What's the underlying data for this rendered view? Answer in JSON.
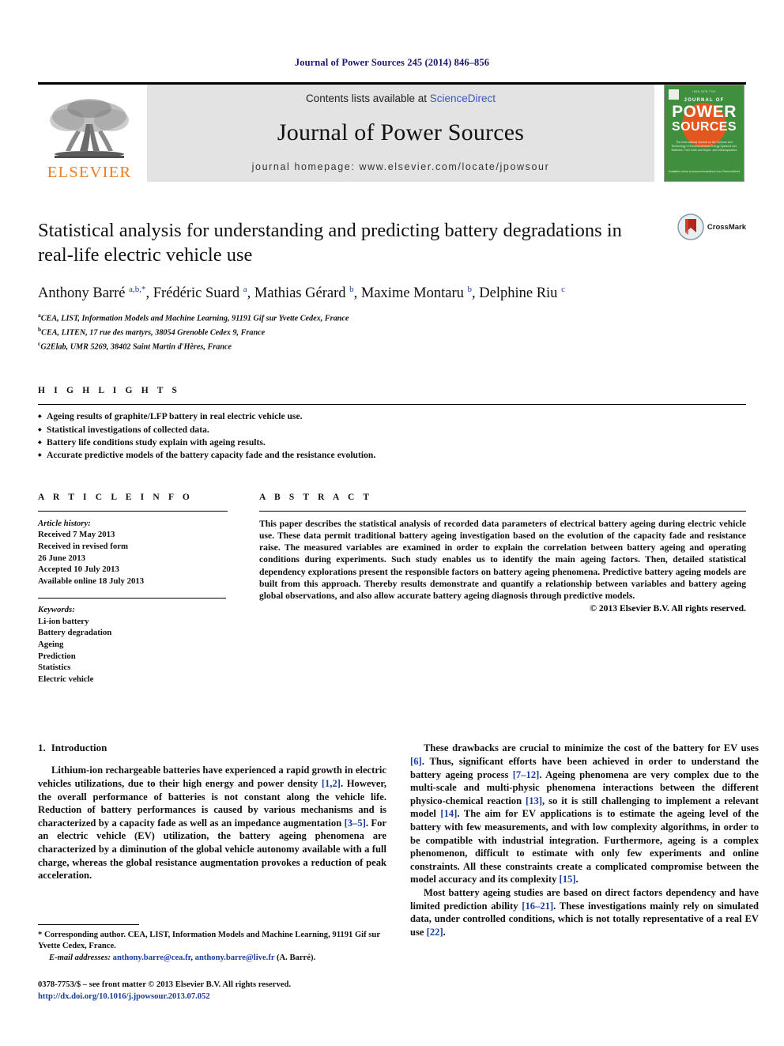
{
  "running_head": "Journal of Power Sources 245 (2014) 846–856",
  "masthead": {
    "publisher_name": "ELSEVIER",
    "contents_prefix": "Contents lists available at ",
    "contents_link": "ScienceDirect",
    "journal_name": "Journal of Power Sources",
    "homepage_line": "journal homepage: www.elsevier.com/locate/jpowsour",
    "cover": {
      "top_text": "ISSN 0378-7753",
      "journal_of": "JOURNAL OF",
      "power": "POWER",
      "sources": "SOURCES",
      "subtitle": "The International Journal on the Science and Technology of Electrochemical Energy Systems incl. Batteries, Fuel Cells and Super- and Ultracapacitors",
      "footer": "Available online at www.sciencedirect.com ScienceDirect"
    },
    "link_color": "#3b55c4",
    "brand_color": "#ef7d21",
    "cover_bg": "#3f8f3f",
    "cover_accent": "#e2571e"
  },
  "article": {
    "title": "Statistical analysis for understanding and predicting battery degradations in real-life electric vehicle use",
    "crossmark_label": "CrossMark",
    "authors_html": "Anthony Barré <sup>a,b,</sup><sup>*</sup>, Frédéric Suard <sup>a</sup>, Mathias Gérard <sup>b</sup>, Maxime Montaru <sup>b</sup>, Delphine Riu <sup>c</sup>",
    "affiliations": [
      {
        "marker": "a",
        "text": "CEA, LIST, Information Models and Machine Learning, 91191 Gif sur Yvette Cedex, France"
      },
      {
        "marker": "b",
        "text": "CEA, LITEN, 17 rue des martyrs, 38054 Grenoble Cedex 9, France"
      },
      {
        "marker": "c",
        "text": "G2Elab, UMR 5269, 38402 Saint Martin d'Hères, France"
      }
    ]
  },
  "highlights": {
    "heading": "H I G H L I G H T S",
    "items": [
      "Ageing results of graphite/LFP battery in real electric vehicle use.",
      "Statistical investigations of collected data.",
      "Battery life conditions study explain with ageing results.",
      "Accurate predictive models of the battery capacity fade and the resistance evolution."
    ]
  },
  "article_info": {
    "heading": "A R T I C L E   I N F O",
    "history_label": "Article history:",
    "history_lines": [
      "Received 7 May 2013",
      "Received in revised form",
      "26 June 2013",
      "Accepted 10 July 2013",
      "Available online 18 July 2013"
    ],
    "keywords_label": "Keywords:",
    "keywords": [
      "Li-ion battery",
      "Battery degradation",
      "Ageing",
      "Prediction",
      "Statistics",
      "Electric vehicle"
    ]
  },
  "abstract": {
    "heading": "A B S T R A C T",
    "text": "This paper describes the statistical analysis of recorded data parameters of electrical battery ageing during electric vehicle use. These data permit traditional battery ageing investigation based on the evolution of the capacity fade and resistance raise. The measured variables are examined in order to explain the correlation between battery ageing and operating conditions during experiments. Such study enables us to identify the main ageing factors. Then, detailed statistical dependency explorations present the responsible factors on battery ageing phenomena. Predictive battery ageing models are built from this approach. Thereby results demonstrate and quantify a relationship between variables and battery ageing global observations, and also allow accurate battery ageing diagnosis through predictive models.",
    "copyright": "© 2013 Elsevier B.V. All rights reserved."
  },
  "body": {
    "section_number": "1.",
    "section_title": "Introduction",
    "left_paragraph_html": "Lithium-ion rechargeable batteries have experienced a rapid growth in electric vehicles utilizations, due to their high energy and power density <span class=\"ref\">[1,2]</span>. However, the overall performance of batteries is not constant along the vehicle life. Reduction of battery performances is caused by various mechanisms and is characterized by a capacity fade as well as an impedance augmentation <span class=\"ref\">[3–5]</span>. For an electric vehicle (EV) utilization, the battery ageing phenomena are characterized by a diminution of the global vehicle autonomy available with a full charge, whereas the global resistance augmentation provokes a reduction of peak acceleration.",
    "right_paragraph_1_html": "These drawbacks are crucial to minimize the cost of the battery for EV uses <span class=\"ref\">[6]</span>. Thus, significant efforts have been achieved in order to understand the battery ageing process <span class=\"ref\">[7–12]</span>. Ageing phenomena are very complex due to the multi-scale and multi-physic phenomena interactions between the different physico-chemical reaction <span class=\"ref\">[13]</span>, so it is still challenging to implement a relevant model <span class=\"ref\">[14]</span>. The aim for EV applications is to estimate the ageing level of the battery with few measurements, and with low complexity algorithms, in order to be compatible with industrial integration. Furthermore, ageing is a complex phenomenon, difficult to estimate with only few experiments and online constraints. All these constraints create a complicated compromise between the model accuracy and its complexity <span class=\"ref\">[15]</span>.",
    "right_paragraph_2_html": "Most battery ageing studies are based on direct factors dependency and have limited prediction ability <span class=\"ref\">[16–21]</span>. These investigations mainly rely on simulated data, under controlled conditions, which is not totally representative of a real EV use <span class=\"ref\">[22]</span>."
  },
  "footnote": {
    "corresponding_html": "* Corresponding author. CEA, LIST, Information Models and Machine Learning, 91191 Gif sur Yvette Cedex, France.",
    "email_html": "<span class=\"it\">E-mail addresses:</span> <span class=\"fn-mail\">anthony.barre@cea.fr</span>, <span class=\"fn-mail\">anthony.barre@live.fr</span> (A. Barré).",
    "imprint_line": "0378-7753/$ – see front matter © 2013 Elsevier B.V. All rights reserved.",
    "doi_line": "http://dx.doi.org/10.1016/j.jpowsour.2013.07.052"
  }
}
